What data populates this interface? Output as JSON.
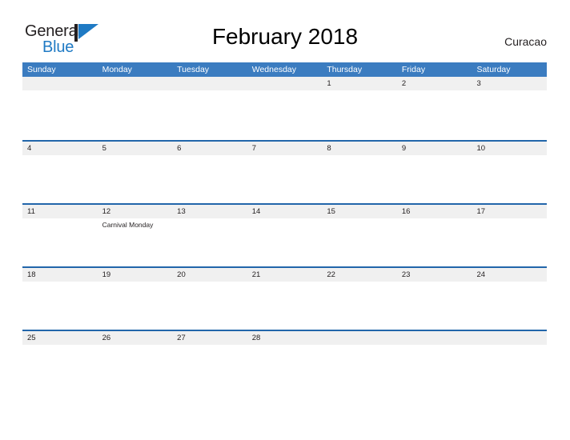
{
  "brand": {
    "name_top": "General",
    "name_bottom": "Blue",
    "accent_color": "#1f7ac4",
    "logo_icon": "flag-triangle-icon"
  },
  "header": {
    "title": "February 2018",
    "region": "Curacao"
  },
  "calendar": {
    "header_bg": "#3b7cc0",
    "row_divider_color": "#2266aa",
    "date_band_bg": "#f0f0f0",
    "weekdays": [
      "Sunday",
      "Monday",
      "Tuesday",
      "Wednesday",
      "Thursday",
      "Friday",
      "Saturday"
    ],
    "weeks": [
      {
        "days": [
          {
            "date": "",
            "events": []
          },
          {
            "date": "",
            "events": []
          },
          {
            "date": "",
            "events": []
          },
          {
            "date": "",
            "events": []
          },
          {
            "date": "1",
            "events": []
          },
          {
            "date": "2",
            "events": []
          },
          {
            "date": "3",
            "events": []
          }
        ]
      },
      {
        "days": [
          {
            "date": "4",
            "events": []
          },
          {
            "date": "5",
            "events": []
          },
          {
            "date": "6",
            "events": []
          },
          {
            "date": "7",
            "events": []
          },
          {
            "date": "8",
            "events": []
          },
          {
            "date": "9",
            "events": []
          },
          {
            "date": "10",
            "events": []
          }
        ]
      },
      {
        "days": [
          {
            "date": "11",
            "events": []
          },
          {
            "date": "12",
            "events": [
              "Carnival Monday"
            ]
          },
          {
            "date": "13",
            "events": []
          },
          {
            "date": "14",
            "events": []
          },
          {
            "date": "15",
            "events": []
          },
          {
            "date": "16",
            "events": []
          },
          {
            "date": "17",
            "events": []
          }
        ]
      },
      {
        "days": [
          {
            "date": "18",
            "events": []
          },
          {
            "date": "19",
            "events": []
          },
          {
            "date": "20",
            "events": []
          },
          {
            "date": "21",
            "events": []
          },
          {
            "date": "22",
            "events": []
          },
          {
            "date": "23",
            "events": []
          },
          {
            "date": "24",
            "events": []
          }
        ]
      },
      {
        "days": [
          {
            "date": "25",
            "events": []
          },
          {
            "date": "26",
            "events": []
          },
          {
            "date": "27",
            "events": []
          },
          {
            "date": "28",
            "events": []
          },
          {
            "date": "",
            "events": []
          },
          {
            "date": "",
            "events": []
          },
          {
            "date": "",
            "events": []
          }
        ]
      }
    ]
  }
}
